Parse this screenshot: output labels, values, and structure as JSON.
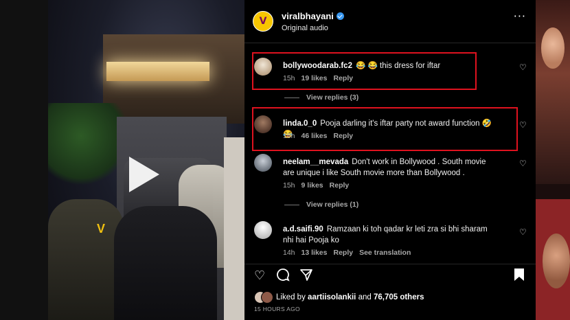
{
  "post": {
    "username": "viralbhayani",
    "audio": "Original audio",
    "more": "···"
  },
  "comments": [
    {
      "user": "bollywoodarab.fc2",
      "text": "😂 😂 this dress for iftar",
      "time": "15h",
      "likes": "19 likes",
      "reply": "Reply",
      "highlighted": true,
      "avatar_color": "#d8c7b0"
    },
    {
      "user": "linda.0_0",
      "text": "Pooja darling it's iftar party not award function 🤣 😂",
      "time": "15h",
      "likes": "46 likes",
      "reply": "Reply",
      "highlighted": true,
      "avatar_color": "#6b4a3a"
    },
    {
      "user": "neelam__mevada",
      "text": "Don't work in Bollywood . South movie are unique i like South movie more than Bollywood .",
      "time": "15h",
      "likes": "9 likes",
      "reply": "Reply",
      "highlighted": false,
      "avatar_color": "#9aa3ad"
    },
    {
      "user": "a.d.saifi.90",
      "text": "Ramzaan ki toh qadar kr leti zra si bhi sharam nhi hai Pooja ko",
      "time": "14h",
      "likes": "13 likes",
      "reply": "Reply",
      "see_translation": "See translation",
      "highlighted": false,
      "avatar_color": "#e0e0e0"
    }
  ],
  "view_replies": [
    "View replies (3)",
    "View replies (1)"
  ],
  "likes": {
    "prefix": "Liked by",
    "user": "aartiisolankii",
    "and": "and",
    "others": "76,705 others"
  },
  "timestamp": "15 HOURS AGO",
  "icons": {
    "heart": "heart-icon",
    "comment": "comment-icon",
    "share": "share-icon",
    "save": "bookmark-icon",
    "play": "play-icon",
    "verified": "verified-icon"
  },
  "colors": {
    "highlight": "#e0121f",
    "verified": "#3897f0",
    "brand_avatar": "#f7c600"
  }
}
